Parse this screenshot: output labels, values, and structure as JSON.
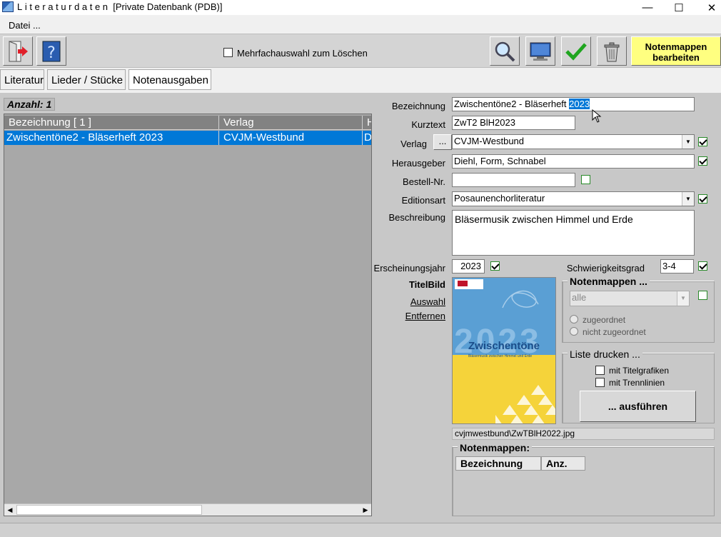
{
  "window": {
    "title_spaced": "Literaturdaten",
    "title_rest": "[Private Datenbank (PDB)]",
    "minimize": "—",
    "maximize": "☐",
    "close": "✕"
  },
  "menu": {
    "datei": "Datei ..."
  },
  "toolbar": {
    "multiselect_label": "Mehrfachauswahl zum Löschen",
    "notenmappen_button": [
      "Notenmappen",
      "bearbeiten"
    ]
  },
  "tabs": [
    "Literatur",
    "Lieder / Stücke",
    "Notenausgaben"
  ],
  "list": {
    "count_label": "Anzahl: 1",
    "columns": [
      "Bezeichnung     [ 1 ]",
      "Verlag",
      "H"
    ],
    "rows": [
      [
        "Zwischentöne2 - Bläserheft 2023",
        "CVJM-Westbund",
        "D"
      ]
    ]
  },
  "form": {
    "bezeichnung_label": "Bezeichnung",
    "bezeichnung_value_plain": "Zwischentöne2 - Bläserheft ",
    "bezeichnung_value_selected": "2023",
    "kurztext_label": "Kurztext",
    "kurztext_value": "ZwT2 BlH2023",
    "verlag_label": "Verlag",
    "verlag_button": "...",
    "verlag_value": "CVJM-Westbund",
    "herausgeber_label": "Herausgeber",
    "herausgeber_value": "Diehl, Form, Schnabel",
    "bestell_label": "Bestell-Nr.",
    "bestell_value": "",
    "editionsart_label": "Editionsart",
    "editionsart_value": "Posaunenchorliteratur",
    "beschreibung_label": "Beschreibung",
    "beschreibung_value": "Bläsermusik zwischen Himmel und Erde",
    "jahr_label": "Erscheinungsjahr",
    "jahr_value": "2023",
    "schwierigkeit_label": "Schwierigkeitsgrad",
    "schwierigkeit_value": "3-4",
    "titelbild_label": "TitelBild",
    "auswahl_link": "Auswahl",
    "entfernen_link": "Entfernen",
    "image_path": "cvjmwestbund\\ZwTBlH2022.jpg"
  },
  "cover": {
    "year": "2023",
    "title": "Zwischentöne",
    "subtitle": "Bläsermusik zwischen Himmel und Erde",
    "blue": "#5a9fd4",
    "yellow": "#f5d33a"
  },
  "notenmappen_box": {
    "title": "Notenmappen ...",
    "filter_value": "alle",
    "radio1": "zugeordnet",
    "radio2": "nicht zugeordnet"
  },
  "print_box": {
    "title": "Liste drucken ...",
    "opt1": "mit Titelgrafiken",
    "opt2": "mit Trennlinien",
    "run_button": "... ausführen"
  },
  "notenmappen_list": {
    "title": "Notenmappen:",
    "columns": [
      "Bezeichnung",
      "Anz."
    ]
  }
}
